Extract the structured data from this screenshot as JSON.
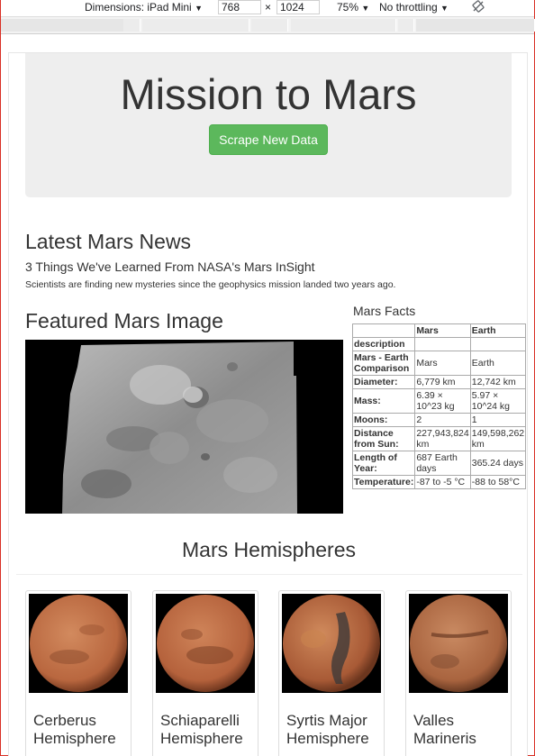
{
  "devtools": {
    "dimensions_label": "Dimensions: iPad Mini",
    "width_value": "768",
    "times": "×",
    "height_value": "1024",
    "zoom": "75%",
    "throttling": "No throttling"
  },
  "header": {
    "title": "Mission to Mars",
    "scrape_label": "Scrape New Data"
  },
  "news": {
    "heading": "Latest Mars News",
    "title": "3 Things We've Learned From NASA's Mars InSight",
    "paragraph": "Scientists are finding new mysteries since the geophysics mission landed two years ago."
  },
  "featured": {
    "heading": "Featured Mars Image"
  },
  "facts": {
    "heading": "Mars Facts",
    "columns": [
      "",
      "Mars",
      "Earth"
    ],
    "rows": [
      {
        "label": "description",
        "mars": "",
        "earth": ""
      },
      {
        "label": "Mars - Earth Comparison",
        "mars": "Mars",
        "earth": "Earth"
      },
      {
        "label": "Diameter:",
        "mars": "6,779 km",
        "earth": "12,742 km"
      },
      {
        "label": "Mass:",
        "mars": "6.39 × 10^23 kg",
        "earth": "5.97 × 10^24 kg"
      },
      {
        "label": "Moons:",
        "mars": "2",
        "earth": "1"
      },
      {
        "label": "Distance from Sun:",
        "mars": "227,943,824 km",
        "earth": "149,598,262 km"
      },
      {
        "label": "Length of Year:",
        "mars": "687 Earth days",
        "earth": "365.24 days"
      },
      {
        "label": "Temperature:",
        "mars": "-87 to -5 °C",
        "earth": "-88 to 58°C"
      }
    ]
  },
  "hemispheres": {
    "heading": "Mars Hemispheres",
    "items": [
      {
        "name": "Cerberus Hemisphere",
        "line1": "Cerberus",
        "line2": "Hemisphere",
        "color": "#b9673f"
      },
      {
        "name": "Schiaparelli Hemisphere",
        "line1": "Schiaparelli",
        "line2": "Hemisphere",
        "color": "#b5623c"
      },
      {
        "name": "Syrtis Major Hemisphere",
        "line1": "Syrtis Major",
        "line2": "Hemisphere",
        "color": "#a85a36"
      },
      {
        "name": "Valles Marineris",
        "line1": "Valles",
        "line2": "Marineris",
        "color": "#a9643f"
      }
    ]
  },
  "colors": {
    "button_green": "#5cb85c",
    "jumbotron_bg": "#eeeeee",
    "frame_red": "#d93025"
  }
}
